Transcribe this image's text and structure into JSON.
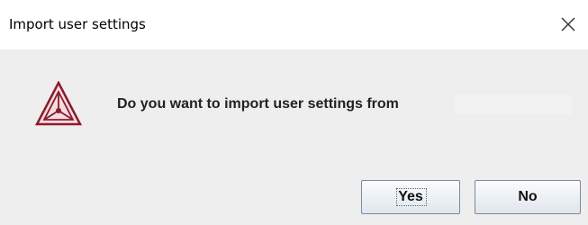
{
  "dialog": {
    "title": "Import user settings",
    "close_icon": "close-icon",
    "message": "Do you want to import user settings from",
    "app_icon": "thermo-calc-triangle-icon",
    "buttons": {
      "yes_label": "Yes",
      "no_label": "No"
    },
    "colors": {
      "icon_accent": "#8b1a2b",
      "body_background": "#eeeeee",
      "titlebar_background": "#ffffff"
    }
  }
}
